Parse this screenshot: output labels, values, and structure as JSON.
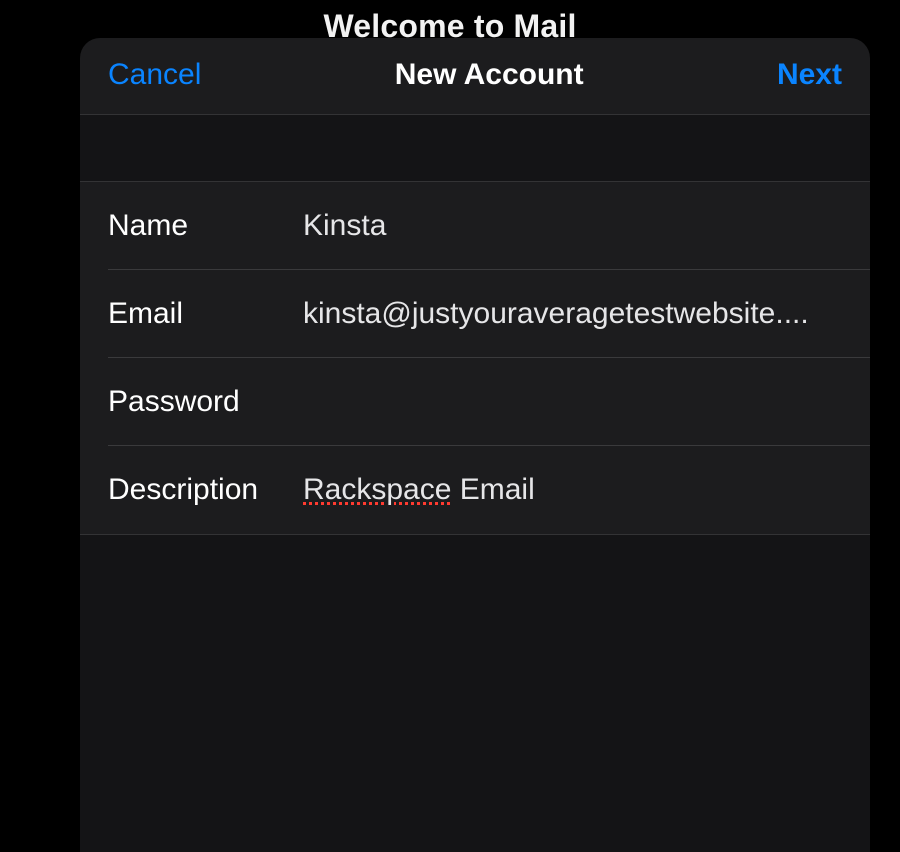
{
  "background": {
    "title": "Welcome to Mail"
  },
  "header": {
    "cancel_label": "Cancel",
    "title": "New Account",
    "next_label": "Next"
  },
  "form": {
    "name": {
      "label": "Name",
      "value": "Kinsta"
    },
    "email": {
      "label": "Email",
      "value": "kinsta@justyouraveragetestwebsite...."
    },
    "password": {
      "label": "Password",
      "value": ""
    },
    "description": {
      "label": "Description",
      "value_misspelled": "Rackspace",
      "value_rest": " Email"
    }
  }
}
